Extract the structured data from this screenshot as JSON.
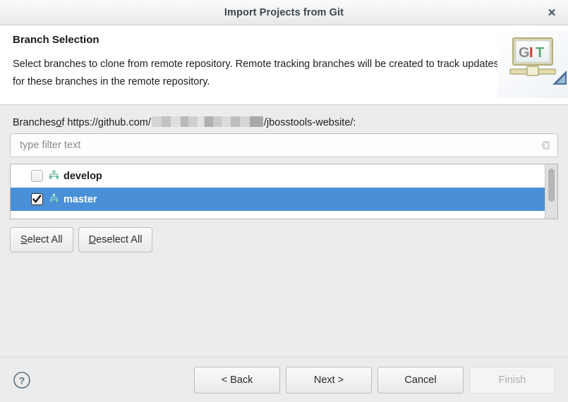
{
  "window": {
    "title": "Import Projects from Git",
    "close_label": "✕",
    "close_icon": "close-icon"
  },
  "header": {
    "title": "Branch Selection",
    "description": "Select branches to clone from remote repository. Remote tracking branches will be created to track updates for these branches in the remote repository.",
    "banner_icon": "git-wizard-banner-icon",
    "banner_text": "GIT"
  },
  "branches": {
    "label_prefix": "Branches ",
    "label_mnemonic": "o",
    "label_middle": "f https://github.com/",
    "redacted_placeholder": "",
    "label_suffix": "/jbosstools-website/:",
    "filter": {
      "value": "",
      "placeholder": "type filter text",
      "clear_icon": "clear-filter-icon"
    },
    "items": [
      {
        "label": "develop",
        "checked": false,
        "selected": false,
        "icon": "git-branch-icon"
      },
      {
        "label": "master",
        "checked": true,
        "selected": true,
        "icon": "git-branch-icon"
      }
    ],
    "select_all_label": "Select All",
    "select_all_mnemonic": "S",
    "deselect_all_label": "Deselect All",
    "deselect_all_mnemonic": "D"
  },
  "footer": {
    "help_icon": "help-question-icon",
    "back_label": "< Back",
    "next_label": "Next >",
    "cancel_label": "Cancel",
    "finish_label": "Finish",
    "finish_enabled": false
  },
  "colors": {
    "selection_blue": "#4a90d9",
    "title_text": "#3b4650",
    "body_background": "#ececec",
    "field_background": "#ffffff"
  }
}
